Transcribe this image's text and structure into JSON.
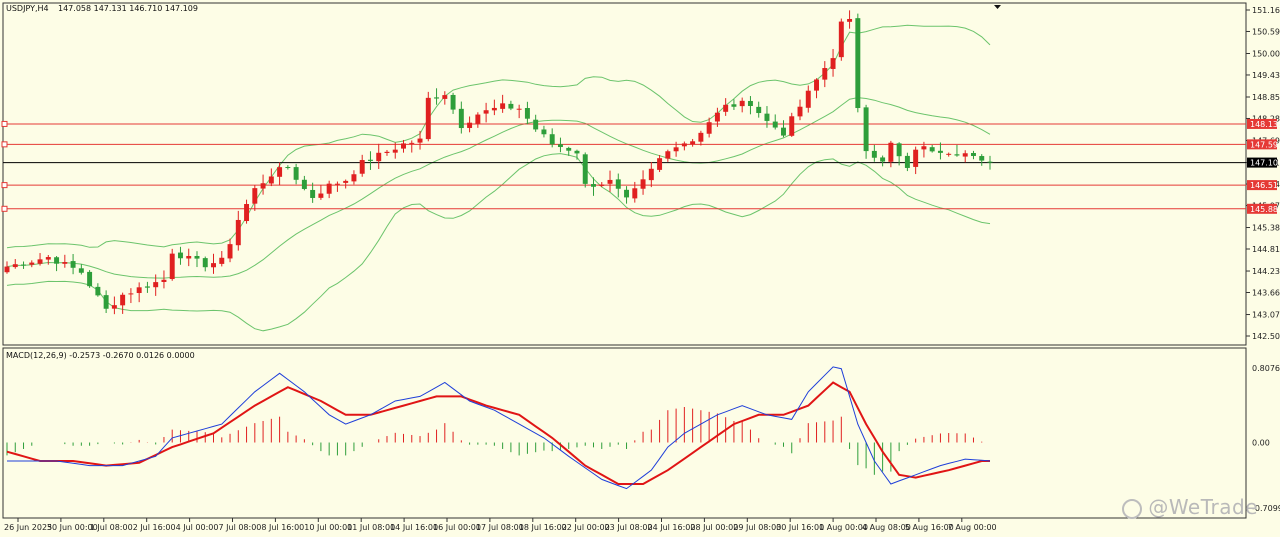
{
  "header": {
    "symbol": "USDJPY,H4",
    "ohlc": "147.058 147.131 146.710 147.109"
  },
  "macd_header": "MACD(12,26,9) -0.2573 -0.2670 0.0126 0.0000",
  "watermark": "@WeTrade",
  "colors": {
    "background": "#fdfde6",
    "bull": "#e02020",
    "bear": "#2e9e3a",
    "bands": "#6cc46c",
    "level_line": "#e53935",
    "current_line": "#000000",
    "macd_line": "#1f3fd9",
    "signal_line": "#e01515"
  },
  "price_axis_ticks": [
    "151.160",
    "150.590",
    "150.005",
    "149.435",
    "148.850",
    "148.280",
    "147.695",
    "147.110",
    "146.540",
    "145.970",
    "145.385",
    "144.815",
    "144.230",
    "143.660",
    "143.075",
    "142.505"
  ],
  "macd_axis_ticks": [
    "0.8076",
    "0.00",
    "-0.7099"
  ],
  "time_axis_labels": [
    "26 Jun 2025",
    "30 Jun 00:00",
    "1 Jul 08:00",
    "2 Jul 16:00",
    "4 Jul 00:00",
    "7 Jul 08:00",
    "8 Jul 16:00",
    "10 Jul 00:00",
    "11 Jul 08:00",
    "14 Jul 16:00",
    "16 Jul 00:00",
    "17 Jul 08:00",
    "18 Jul 16:00",
    "22 Jul 00:00",
    "23 Jul 08:00",
    "24 Jul 16:00",
    "28 Jul 00:00",
    "29 Jul 08:00",
    "30 Jul 16:00",
    "1 Aug 00:00",
    "4 Aug 08:00",
    "5 Aug 16:00",
    "7 Aug 00:00"
  ],
  "level_lines": [
    {
      "price": 148.135,
      "label": "148.135"
    },
    {
      "price": 147.593,
      "label": "147.593"
    },
    {
      "price": 146.511,
      "label": "146.511"
    },
    {
      "price": 145.882,
      "label": "145.882"
    }
  ],
  "current_price": {
    "price": 147.109,
    "label": "147.109"
  },
  "chart_data": {
    "type": "candlestick",
    "price_range": [
      142.505,
      151.16
    ],
    "macd_range": [
      -0.7099,
      0.8076
    ],
    "candle_count": 120,
    "close_path": [
      [
        0,
        144.35
      ],
      [
        5,
        144.6
      ],
      [
        9,
        144.2
      ],
      [
        12,
        143.2
      ],
      [
        14,
        143.6
      ],
      [
        17,
        143.85
      ],
      [
        19,
        144.0
      ],
      [
        20,
        144.75
      ],
      [
        22,
        144.55
      ],
      [
        24,
        144.4
      ],
      [
        26,
        144.5
      ],
      [
        27,
        145.0
      ],
      [
        28,
        145.6
      ],
      [
        30,
        146.4
      ],
      [
        32,
        146.8
      ],
      [
        34,
        147.0
      ],
      [
        36,
        146.4
      ],
      [
        37,
        146.2
      ],
      [
        39,
        146.5
      ],
      [
        41,
        146.65
      ],
      [
        43,
        147.1
      ],
      [
        46,
        147.4
      ],
      [
        48,
        147.6
      ],
      [
        50,
        147.7
      ],
      [
        51,
        148.8
      ],
      [
        53,
        148.95
      ],
      [
        55,
        148.1
      ],
      [
        57,
        148.4
      ],
      [
        60,
        148.6
      ],
      [
        62,
        148.55
      ],
      [
        64,
        148.0
      ],
      [
        66,
        147.6
      ],
      [
        69,
        147.4
      ],
      [
        70,
        146.5
      ],
      [
        73,
        146.6
      ],
      [
        75,
        146.1
      ],
      [
        77,
        146.6
      ],
      [
        79,
        147.2
      ],
      [
        81,
        147.6
      ],
      [
        83,
        147.7
      ],
      [
        85,
        148.2
      ],
      [
        87,
        148.6
      ],
      [
        90,
        148.7
      ],
      [
        92,
        148.2
      ],
      [
        94,
        147.9
      ],
      [
        96,
        148.6
      ],
      [
        98,
        149.3
      ],
      [
        100,
        149.95
      ],
      [
        101,
        150.8
      ],
      [
        102,
        150.85
      ],
      [
        103,
        148.6
      ],
      [
        104,
        147.5
      ],
      [
        106,
        147.1
      ],
      [
        107,
        147.6
      ],
      [
        109,
        146.9
      ],
      [
        110,
        147.5
      ],
      [
        113,
        147.45
      ],
      [
        116,
        147.35
      ],
      [
        118,
        147.1
      ],
      [
        119,
        147.109
      ]
    ],
    "macd_path": [
      [
        0,
        -0.2
      ],
      [
        6,
        -0.2
      ],
      [
        10,
        -0.25
      ],
      [
        14,
        -0.25
      ],
      [
        18,
        -0.15
      ],
      [
        20,
        0.05
      ],
      [
        26,
        0.2
      ],
      [
        30,
        0.55
      ],
      [
        33,
        0.75
      ],
      [
        36,
        0.55
      ],
      [
        39,
        0.3
      ],
      [
        41,
        0.2
      ],
      [
        44,
        0.3
      ],
      [
        47,
        0.45
      ],
      [
        50,
        0.5
      ],
      [
        53,
        0.65
      ],
      [
        56,
        0.45
      ],
      [
        59,
        0.35
      ],
      [
        62,
        0.2
      ],
      [
        65,
        0.05
      ],
      [
        68,
        -0.15
      ],
      [
        72,
        -0.4
      ],
      [
        75,
        -0.5
      ],
      [
        78,
        -0.3
      ],
      [
        80,
        -0.05
      ],
      [
        82,
        0.1
      ],
      [
        86,
        0.3
      ],
      [
        89,
        0.4
      ],
      [
        92,
        0.3
      ],
      [
        95,
        0.25
      ],
      [
        97,
        0.55
      ],
      [
        100,
        0.82
      ],
      [
        101,
        0.8
      ],
      [
        103,
        0.2
      ],
      [
        105,
        -0.2
      ],
      [
        107,
        -0.45
      ],
      [
        110,
        -0.35
      ],
      [
        113,
        -0.25
      ],
      [
        116,
        -0.18
      ],
      [
        119,
        -0.2
      ]
    ],
    "signal_path": [
      [
        0,
        -0.1
      ],
      [
        4,
        -0.2
      ],
      [
        8,
        -0.2
      ],
      [
        12,
        -0.25
      ],
      [
        16,
        -0.22
      ],
      [
        20,
        -0.05
      ],
      [
        25,
        0.1
      ],
      [
        30,
        0.4
      ],
      [
        34,
        0.6
      ],
      [
        38,
        0.45
      ],
      [
        41,
        0.3
      ],
      [
        44,
        0.3
      ],
      [
        48,
        0.4
      ],
      [
        52,
        0.5
      ],
      [
        55,
        0.5
      ],
      [
        58,
        0.4
      ],
      [
        62,
        0.3
      ],
      [
        66,
        0.05
      ],
      [
        70,
        -0.25
      ],
      [
        74,
        -0.45
      ],
      [
        77,
        -0.45
      ],
      [
        80,
        -0.3
      ],
      [
        84,
        -0.05
      ],
      [
        88,
        0.2
      ],
      [
        91,
        0.3
      ],
      [
        94,
        0.3
      ],
      [
        97,
        0.4
      ],
      [
        100,
        0.65
      ],
      [
        102,
        0.55
      ],
      [
        104,
        0.2
      ],
      [
        106,
        -0.1
      ],
      [
        108,
        -0.35
      ],
      [
        110,
        -0.38
      ],
      [
        114,
        -0.3
      ],
      [
        118,
        -0.2
      ],
      [
        119,
        -0.2
      ]
    ]
  }
}
